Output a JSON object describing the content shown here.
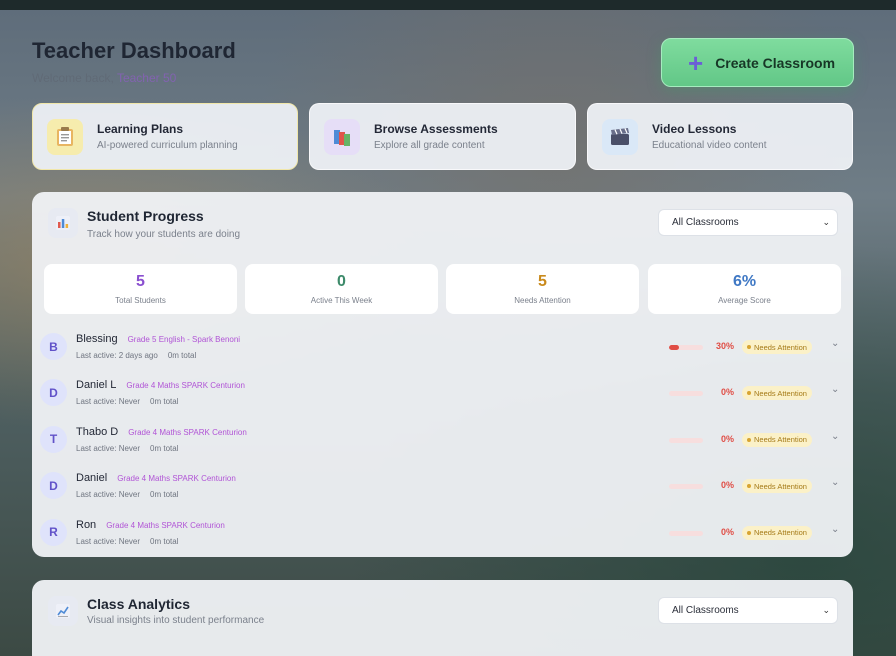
{
  "header": {
    "title": "Teacher Dashboard",
    "welcome_prefix": "Welcome back,",
    "welcome_name": "Teacher 50"
  },
  "create_button": {
    "label": "Create Classroom"
  },
  "quick_links": [
    {
      "title": "Learning Plans",
      "desc": "AI-powered curriculum planning",
      "icon": "clipboard-icon"
    },
    {
      "title": "Browse Assessments",
      "desc": "Explore all grade content",
      "icon": "books-icon"
    },
    {
      "title": "Video Lessons",
      "desc": "Educational video content",
      "icon": "clapperboard-icon"
    }
  ],
  "progress": {
    "title": "Student Progress",
    "subtitle": "Track how your students are doing",
    "select": "All Classrooms",
    "stats": [
      {
        "value": "5",
        "label": "Total Students",
        "color": "#8a4fd0"
      },
      {
        "value": "0",
        "label": "Active This Week",
        "color": "#3d8a6a"
      },
      {
        "value": "5",
        "label": "Needs Attention",
        "color": "#c98a1c"
      },
      {
        "value": "6%",
        "label": "Average Score",
        "color": "#3f78c4"
      }
    ],
    "students": [
      {
        "initial": "B",
        "name": "Blessing",
        "class": "Grade 5 English - Spark Benoni",
        "last_active": "Last active: 2 days ago",
        "time": "0m total",
        "percent": "30%",
        "progress": 0.3,
        "status": "Needs Attention"
      },
      {
        "initial": "D",
        "name": "Daniel L",
        "class": "Grade 4 Maths SPARK Centurion",
        "last_active": "Last active: Never",
        "time": "0m total",
        "percent": "0%",
        "progress": 0,
        "status": "Needs Attention"
      },
      {
        "initial": "T",
        "name": "Thabo D",
        "class": "Grade 4 Maths SPARK Centurion",
        "last_active": "Last active: Never",
        "time": "0m total",
        "percent": "0%",
        "progress": 0,
        "status": "Needs Attention"
      },
      {
        "initial": "D",
        "name": "Daniel",
        "class": "Grade 4 Maths SPARK Centurion",
        "last_active": "Last active: Never",
        "time": "0m total",
        "percent": "0%",
        "progress": 0,
        "status": "Needs Attention"
      },
      {
        "initial": "R",
        "name": "Ron",
        "class": "Grade 4 Maths SPARK Centurion",
        "last_active": "Last active: Never",
        "time": "0m total",
        "percent": "0%",
        "progress": 0,
        "status": "Needs Attention"
      }
    ]
  },
  "analytics": {
    "title": "Class Analytics",
    "subtitle": "Visual insights into student performance",
    "select": "All Classrooms"
  }
}
